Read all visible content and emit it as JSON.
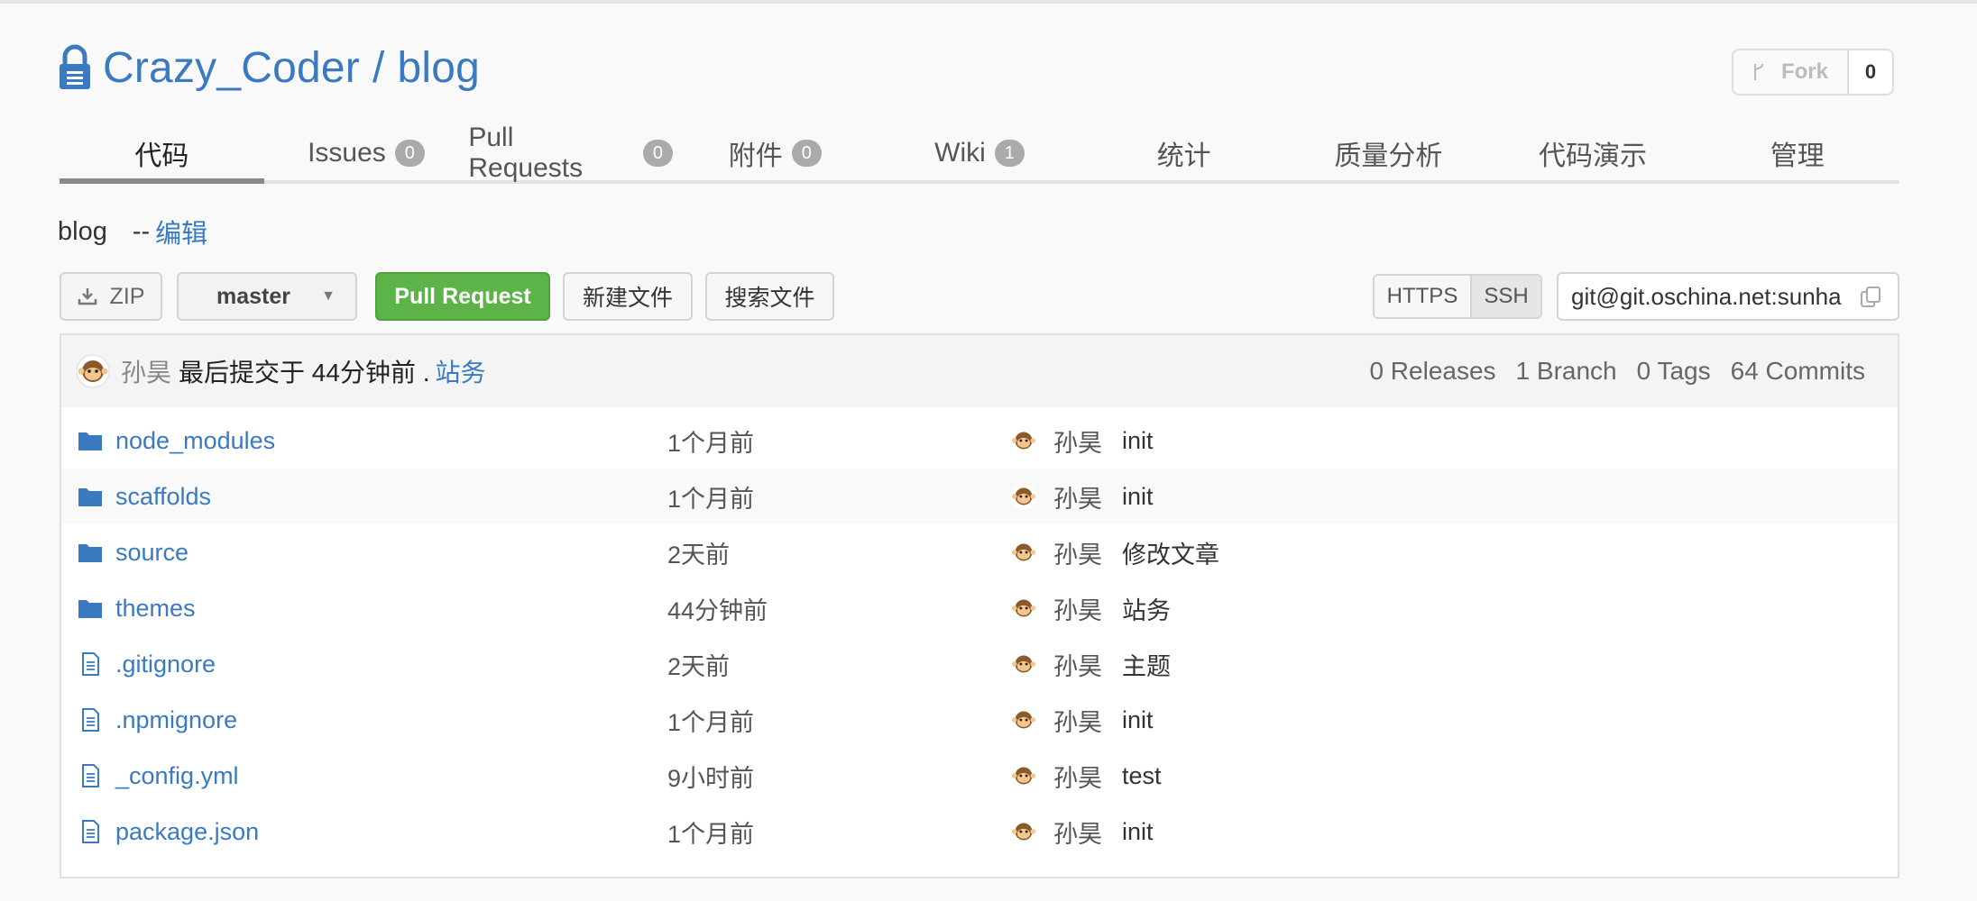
{
  "repo": {
    "owner": "Crazy_Coder",
    "separator": "/",
    "name": "blog",
    "fork_label": "Fork",
    "fork_count": "0"
  },
  "tabs": [
    {
      "label": "代码",
      "badge": null,
      "active": true
    },
    {
      "label": "Issues",
      "badge": "0"
    },
    {
      "label": "Pull Requests",
      "badge": "0"
    },
    {
      "label": "附件",
      "badge": "0"
    },
    {
      "label": "Wiki",
      "badge": "1"
    },
    {
      "label": "统计",
      "badge": null
    },
    {
      "label": "质量分析",
      "badge": null
    },
    {
      "label": "代码演示",
      "badge": null
    },
    {
      "label": "管理",
      "badge": null
    }
  ],
  "description": {
    "text": "blog",
    "dash": "--",
    "edit_label": "编辑"
  },
  "toolbar": {
    "zip_label": "ZIP",
    "branch": "master",
    "pull_request_label": "Pull Request",
    "new_file_label": "新建文件",
    "search_file_label": "搜索文件",
    "https_label": "HTTPS",
    "ssh_label": "SSH",
    "clone_url": "git@git.oschina.net:sunhao"
  },
  "last_commit": {
    "author": "孙昊",
    "text": "最后提交于 44分钟前 .",
    "message": "站务"
  },
  "stats": {
    "releases": "0 Releases",
    "branches": "1 Branch",
    "tags": "0 Tags",
    "commits": "64 Commits"
  },
  "files": [
    {
      "name": "node_modules",
      "type": "folder",
      "time": "1个月前",
      "author": "孙昊",
      "message": "init"
    },
    {
      "name": "scaffolds",
      "type": "folder",
      "time": "1个月前",
      "author": "孙昊",
      "message": "init"
    },
    {
      "name": "source",
      "type": "folder",
      "time": "2天前",
      "author": "孙昊",
      "message": "修改文章"
    },
    {
      "name": "themes",
      "type": "folder",
      "time": "44分钟前",
      "author": "孙昊",
      "message": "站务"
    },
    {
      "name": ".gitignore",
      "type": "file",
      "time": "2天前",
      "author": "孙昊",
      "message": "主题"
    },
    {
      "name": ".npmignore",
      "type": "file",
      "time": "1个月前",
      "author": "孙昊",
      "message": "init"
    },
    {
      "name": "_config.yml",
      "type": "file",
      "time": "9小时前",
      "author": "孙昊",
      "message": "test"
    },
    {
      "name": "package.json",
      "type": "file",
      "time": "1个月前",
      "author": "孙昊",
      "message": "init"
    }
  ],
  "colors": {
    "link": "#3a7ac0",
    "pr_button": "#5cb348",
    "badge": "#aaaaaa"
  }
}
